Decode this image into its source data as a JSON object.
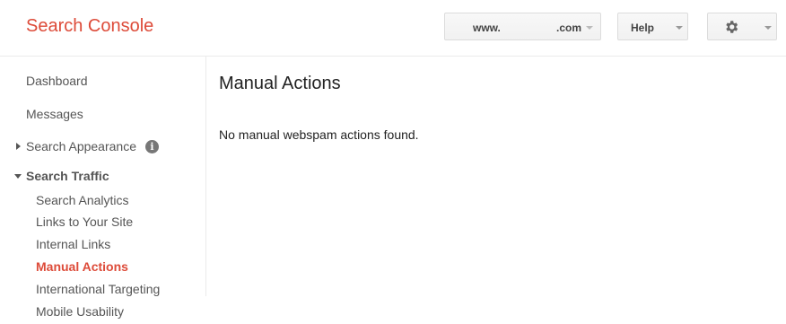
{
  "header": {
    "app_title": "Search Console",
    "site_selector": {
      "prefix": "www.",
      "suffix": ".com"
    },
    "help_label": "Help",
    "settings_icon": "gear-icon"
  },
  "sidebar": {
    "items": [
      {
        "label": "Dashboard"
      },
      {
        "label": "Messages"
      },
      {
        "label": "Search Appearance",
        "icon": "info-icon",
        "info_glyph": "i"
      }
    ],
    "section": {
      "label": "Search Traffic",
      "children": [
        {
          "label": "Search Analytics"
        },
        {
          "label": "Links to Your Site"
        },
        {
          "label": "Internal Links"
        },
        {
          "label": "Manual Actions",
          "active": true
        },
        {
          "label": "International Targeting"
        },
        {
          "label": "Mobile Usability"
        }
      ]
    }
  },
  "main": {
    "title": "Manual Actions",
    "message": "No manual webspam actions found."
  },
  "colors": {
    "brand": "#dd4b39",
    "active_nav": "#dd4b39",
    "text": "#444444"
  }
}
